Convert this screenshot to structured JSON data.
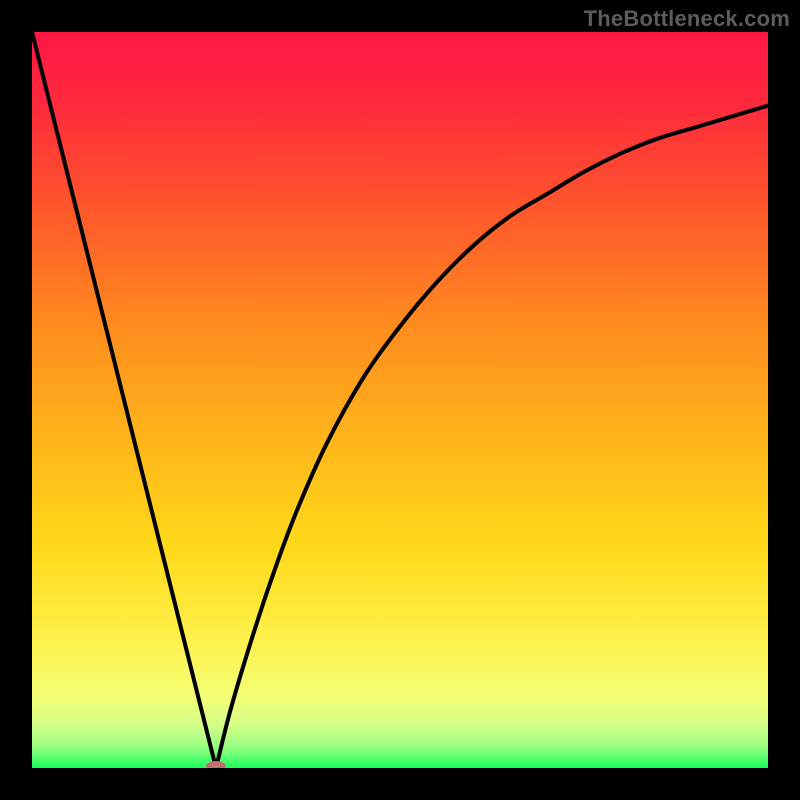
{
  "watermark": "TheBottleneck.com",
  "colors": {
    "black": "#000000",
    "gradient_stops": [
      {
        "offset": 0.0,
        "color": "#ff1744"
      },
      {
        "offset": 0.1,
        "color": "#ff2a3c"
      },
      {
        "offset": 0.25,
        "color": "#ff5a2a"
      },
      {
        "offset": 0.4,
        "color": "#ff8c1f"
      },
      {
        "offset": 0.55,
        "color": "#ffb41a"
      },
      {
        "offset": 0.7,
        "color": "#ffd91a"
      },
      {
        "offset": 0.82,
        "color": "#fff04a"
      },
      {
        "offset": 0.9,
        "color": "#f4ff72"
      },
      {
        "offset": 0.94,
        "color": "#d6ff88"
      },
      {
        "offset": 0.97,
        "color": "#9cff82"
      },
      {
        "offset": 1.0,
        "color": "#1bff5e"
      }
    ],
    "marker": "#c07070",
    "curve": "#000000"
  },
  "chart_data": {
    "type": "line",
    "title": "",
    "xlabel": "",
    "ylabel": "",
    "xlim": [
      0,
      100
    ],
    "ylim": [
      0,
      100
    ],
    "grid": false,
    "series": [
      {
        "name": "left-branch",
        "x": [
          0,
          2,
          4,
          6,
          8,
          10,
          12,
          14,
          16,
          18,
          20,
          22,
          24,
          25
        ],
        "y": [
          100,
          92,
          84,
          76,
          68,
          60,
          52,
          44,
          36,
          28,
          20,
          12,
          4,
          0
        ]
      },
      {
        "name": "right-branch",
        "x": [
          25,
          27,
          30,
          33,
          36,
          40,
          45,
          50,
          55,
          60,
          65,
          70,
          75,
          80,
          85,
          90,
          95,
          100
        ],
        "y": [
          0,
          8,
          18,
          27,
          35,
          44,
          53,
          60,
          66,
          71,
          75,
          78,
          81,
          83.5,
          85.5,
          87,
          88.5,
          90
        ]
      }
    ],
    "annotations": [
      {
        "name": "min-marker",
        "x": 25,
        "y": 0
      }
    ]
  }
}
